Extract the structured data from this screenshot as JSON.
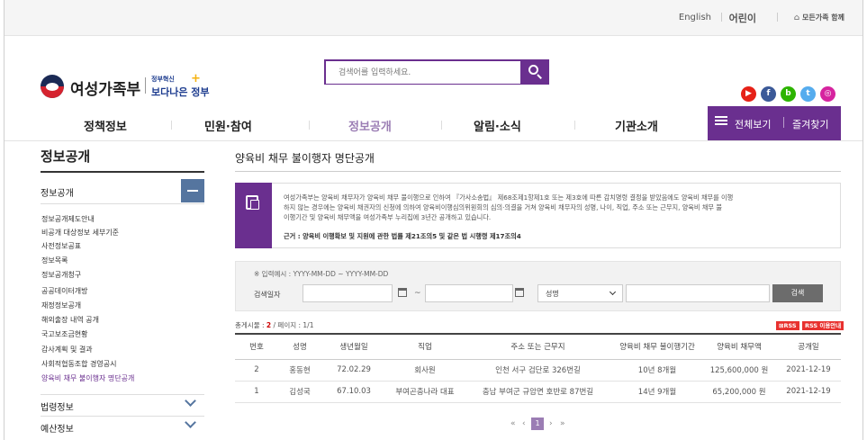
{
  "utility": {
    "english": "English",
    "kids": "어린이",
    "family": "모든가족 함께"
  },
  "header": {
    "logo_text": "여성가족부",
    "logo_sub_small": "정부혁신",
    "logo_sub_large": "보다나은 정부",
    "search_placeholder": "검색어를 입력하세요."
  },
  "sns": [
    {
      "name": "youtube-icon",
      "glyph": "▶",
      "color": "#e62117"
    },
    {
      "name": "facebook-icon",
      "glyph": "f",
      "color": "#3b5998"
    },
    {
      "name": "blog-icon",
      "glyph": "b",
      "color": "#2db400"
    },
    {
      "name": "twitter-icon",
      "glyph": "t",
      "color": "#55acee"
    },
    {
      "name": "instagram-icon",
      "glyph": "◎",
      "color": "#d6249f"
    }
  ],
  "gnb": {
    "items": [
      "정책정보",
      "민원·참여",
      "정보공개",
      "알림·소식",
      "기관소개"
    ],
    "active_index": 2,
    "all_menu": "전체보기",
    "favorites": "즐겨찾기"
  },
  "lnb": {
    "title": "정보공개",
    "group_label": "정보공개",
    "sub_items": [
      "정보공개제도안내",
      "비공개 대상정보 세부기준",
      "사전정보공표",
      "정보목록",
      "정보공개청구",
      "공공데이터개방",
      "재정정보공개",
      "해외출장 내역 공개",
      "국고보조금현황",
      "감사계획 및 결과",
      "사회적협동조합 경영공시",
      "양육비 채무 불이행자 명단공개"
    ],
    "active_sub_index": 11,
    "categories": [
      "법령정보",
      "예산정보"
    ]
  },
  "content": {
    "title": "양육비 채무 불이행자 명단공개",
    "notice_lines": [
      "여성가족부는 양육비 채무자가 양육비 채무 불이행으로 인하여 『가사소송법』 제68조제1항제1호 또는 제3호에 따른 감치명령 결정을 받았음에도 양육비 채무를 이행",
      "하지 않는 경우에는 양육비 채권자의 신청에 의하여 양육비이행심의위원회의 심의·의결을 거쳐 양육비 채무자의 성명, 나이, 직업, 주소 또는 근무지, 양육비 채무 불",
      "이행기간 및 양육비 채무액을 여성가족부 누리집에 3년간 공개하고 있습니다."
    ],
    "notice_basis": "근거 : 양육비 이행확보 및 지원에 관한 법률 제21조의5 및 같은 법 시행령 제17조의4",
    "filter": {
      "hint": "※ 입력예시 : YYYY-MM-DD ~ YYYY-MM-DD",
      "label": "검색일자",
      "tilde": "~",
      "select_value": "성명",
      "search_button": "검색"
    },
    "count_prefix": "총게시물 : ",
    "count_value": "2",
    "count_suffix": " / 페이지 : 1/1",
    "rss_label": "RSS",
    "rss_guide_label": "RSS 이용안내",
    "table": {
      "headers": [
        "번호",
        "성명",
        "생년월일",
        "직업",
        "주소 또는 근무지",
        "양육비 채무 불이행기간",
        "양육비 채무액",
        "공개일"
      ],
      "rows": [
        [
          "2",
          "홍동현",
          "72.02.29",
          "회사원",
          "인천 서구 검단로 326번길",
          "10년 8개월",
          "125,600,000 원",
          "2021-12-19"
        ],
        [
          "1",
          "김성국",
          "67.10.03",
          "부여곤충나라 대표",
          "충남 부여군 규암면 호반로 87번길",
          "14년 9개월",
          "65,200,000 원",
          "2021-12-19"
        ]
      ]
    },
    "pager": {
      "first": "«",
      "prev": "‹",
      "current": "1",
      "next": "›",
      "last": "»"
    }
  },
  "colors": {
    "accent": "#6a2f8f",
    "nav_active": "#9b7db4",
    "lnb_blue": "#55759f",
    "rss_red": "#e8312f"
  }
}
